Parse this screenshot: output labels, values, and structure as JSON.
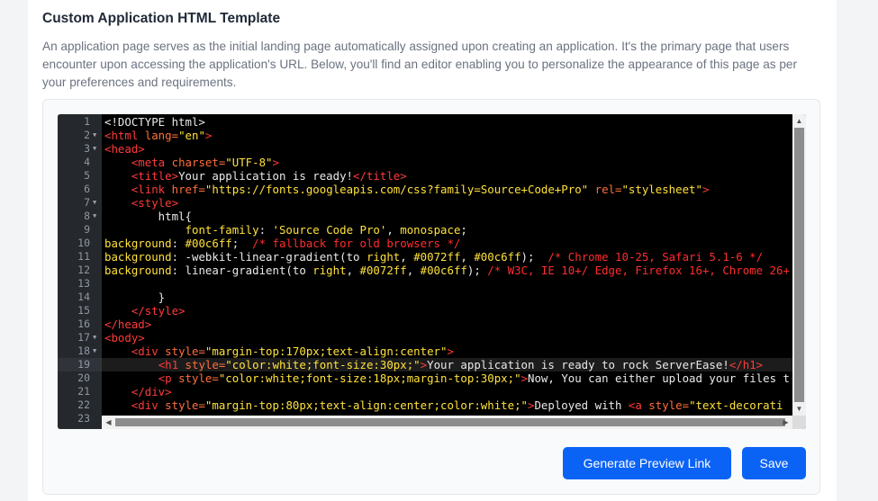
{
  "section": {
    "title": "Custom Application HTML Template",
    "description": "An application page serves as the initial landing page automatically assigned upon creating an application. It's the primary page that users encounter upon accessing the application's URL. Below, you'll find an editor enabling you to personalize the appearance of this page as per your preferences and requirements."
  },
  "editor": {
    "active_line": 19,
    "fold_lines": [
      2,
      3,
      7,
      8,
      17,
      18
    ],
    "lines": [
      {
        "n": "1",
        "segs": [
          [
            "p",
            "<!DOCTYPE html>"
          ]
        ]
      },
      {
        "n": "2",
        "segs": [
          [
            "t",
            "<html "
          ],
          [
            "a",
            "lang="
          ],
          [
            "s",
            "\"en\""
          ],
          [
            "t",
            ">"
          ]
        ]
      },
      {
        "n": "3",
        "segs": [
          [
            "t",
            "<head>"
          ]
        ]
      },
      {
        "n": "4",
        "segs": [
          [
            "p",
            "    "
          ],
          [
            "t",
            "<meta "
          ],
          [
            "a",
            "charset="
          ],
          [
            "s",
            "\"UTF-8\""
          ],
          [
            "t",
            ">"
          ]
        ]
      },
      {
        "n": "5",
        "segs": [
          [
            "p",
            "    "
          ],
          [
            "t",
            "<title>"
          ],
          [
            "p",
            "Your application is ready!"
          ],
          [
            "t",
            "</title>"
          ]
        ]
      },
      {
        "n": "6",
        "segs": [
          [
            "p",
            "    "
          ],
          [
            "t",
            "<link "
          ],
          [
            "a",
            "href="
          ],
          [
            "s",
            "\"https://fonts.googleapis.com/css?family=Source+Code+Pro\""
          ],
          [
            "p",
            " "
          ],
          [
            "a",
            "rel="
          ],
          [
            "s",
            "\"stylesheet\""
          ],
          [
            "t",
            ">"
          ]
        ]
      },
      {
        "n": "7",
        "segs": [
          [
            "p",
            "    "
          ],
          [
            "t",
            "<style>"
          ]
        ]
      },
      {
        "n": "8",
        "segs": [
          [
            "p",
            "        html{"
          ]
        ]
      },
      {
        "n": "9",
        "segs": [
          [
            "p",
            "            "
          ],
          [
            "k",
            "font-family"
          ],
          [
            "p",
            ": "
          ],
          [
            "s",
            "'Source Code Pro'"
          ],
          [
            "p",
            ", "
          ],
          [
            "k",
            "monospace"
          ],
          [
            "p",
            ";"
          ]
        ]
      },
      {
        "n": "10",
        "segs": [
          [
            "k",
            "background"
          ],
          [
            "p",
            ": "
          ],
          [
            "n2",
            "#00c6ff"
          ],
          [
            "p",
            ";  "
          ],
          [
            "c",
            "/* fallback for old browsers */"
          ]
        ]
      },
      {
        "n": "11",
        "segs": [
          [
            "k",
            "background"
          ],
          [
            "p",
            ": -webkit-linear-gradient(to "
          ],
          [
            "k",
            "right"
          ],
          [
            "p",
            ", "
          ],
          [
            "n2",
            "#0072ff"
          ],
          [
            "p",
            ", "
          ],
          [
            "n2",
            "#00c6ff"
          ],
          [
            "p",
            ");  "
          ],
          [
            "c",
            "/* Chrome 10-25, Safari 5.1-6 */"
          ]
        ]
      },
      {
        "n": "12",
        "segs": [
          [
            "k",
            "background"
          ],
          [
            "p",
            ": linear-gradient(to "
          ],
          [
            "k",
            "right"
          ],
          [
            "p",
            ", "
          ],
          [
            "n2",
            "#0072ff"
          ],
          [
            "p",
            ", "
          ],
          [
            "n2",
            "#00c6ff"
          ],
          [
            "p",
            "); "
          ],
          [
            "c",
            "/* W3C, IE 10+/ Edge, Firefox 16+, Chrome 26+"
          ]
        ]
      },
      {
        "n": "13",
        "segs": [
          [
            "p",
            ""
          ]
        ]
      },
      {
        "n": "14",
        "segs": [
          [
            "p",
            "        }"
          ]
        ]
      },
      {
        "n": "15",
        "segs": [
          [
            "p",
            "    "
          ],
          [
            "t",
            "</style>"
          ]
        ]
      },
      {
        "n": "16",
        "segs": [
          [
            "t",
            "</head>"
          ]
        ]
      },
      {
        "n": "17",
        "segs": [
          [
            "t",
            "<body>"
          ]
        ]
      },
      {
        "n": "18",
        "segs": [
          [
            "p",
            "    "
          ],
          [
            "t",
            "<div "
          ],
          [
            "a",
            "style="
          ],
          [
            "s",
            "\"margin-top:170px;text-align:center\""
          ],
          [
            "t",
            ">"
          ]
        ]
      },
      {
        "n": "19",
        "segs": [
          [
            "p",
            "        "
          ],
          [
            "t",
            "<h1 "
          ],
          [
            "a",
            "style="
          ],
          [
            "s",
            "\"color:white;font-size:30px;\""
          ],
          [
            "t",
            ">"
          ],
          [
            "p",
            "Your application is ready to rock ServerEase!"
          ],
          [
            "t",
            "</h1>"
          ]
        ]
      },
      {
        "n": "20",
        "segs": [
          [
            "p",
            "        "
          ],
          [
            "t",
            "<p "
          ],
          [
            "a",
            "style="
          ],
          [
            "s",
            "\"color:white;font-size:18px;margin-top:30px;\""
          ],
          [
            "t",
            ">"
          ],
          [
            "p",
            "Now, You can either upload your files t"
          ]
        ]
      },
      {
        "n": "21",
        "segs": [
          [
            "p",
            "    "
          ],
          [
            "t",
            "</div>"
          ]
        ]
      },
      {
        "n": "22",
        "segs": [
          [
            "p",
            "    "
          ],
          [
            "t",
            "<div "
          ],
          [
            "a",
            "style="
          ],
          [
            "s",
            "\"margin-top:80px;text-align:center;color:white;\""
          ],
          [
            "t",
            ">"
          ],
          [
            "p",
            "Deployed with "
          ],
          [
            "t",
            "<a "
          ],
          [
            "a",
            "style="
          ],
          [
            "s",
            "\"text-decorati"
          ]
        ]
      },
      {
        "n": "23",
        "segs": [
          [
            "p",
            ""
          ]
        ]
      }
    ]
  },
  "actions": {
    "preview_label": "Generate Preview Link",
    "save_label": "Save"
  },
  "colors": {
    "primary_button": "#0b63f6",
    "editor_background": "#000000",
    "gutter_background": "#25282c"
  }
}
